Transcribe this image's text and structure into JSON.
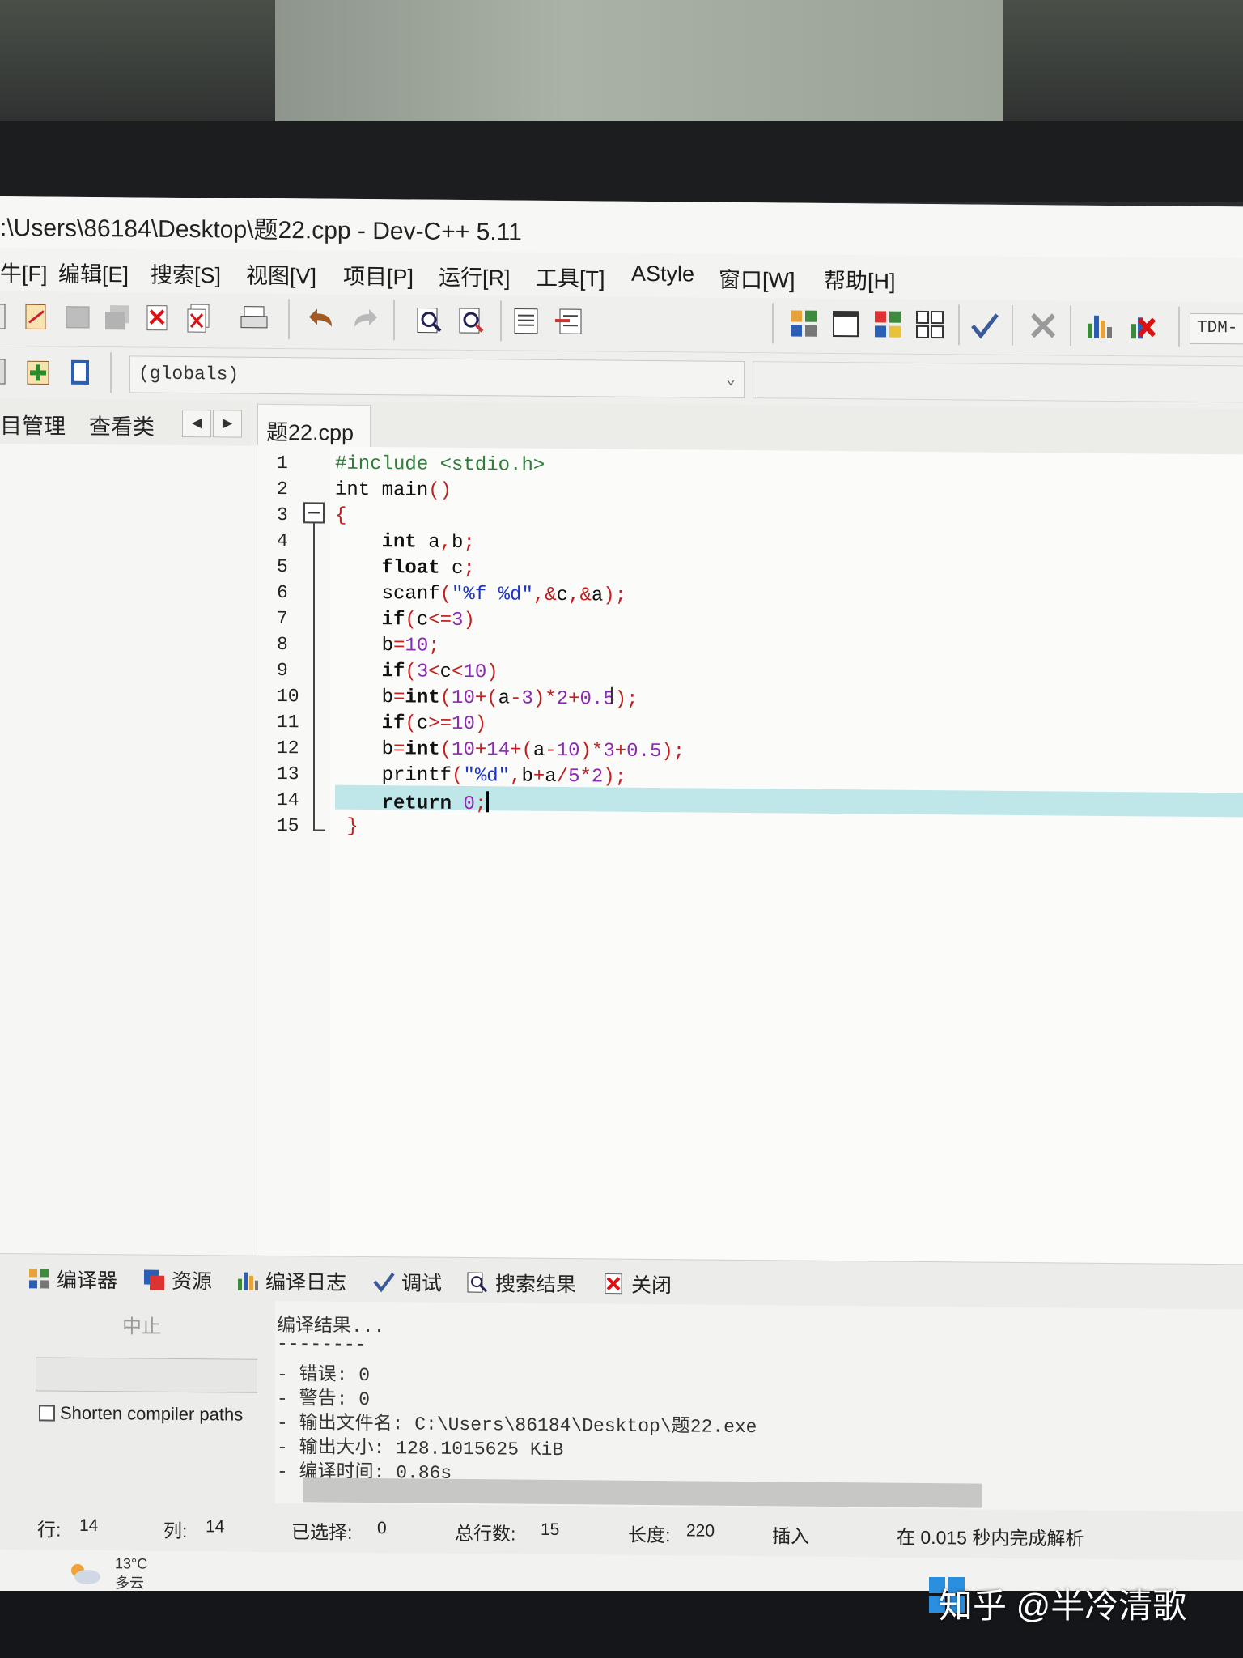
{
  "window": {
    "title": ":\\Users\\86184\\Desktop\\题22.cpp - Dev-C++ 5.11"
  },
  "menu": [
    "牛[F]",
    "编辑[E]",
    "搜索[S]",
    "视图[V]",
    "项目[P]",
    "运行[R]",
    "工具[T]",
    "AStyle",
    "窗口[W]",
    "帮助[H]"
  ],
  "toolbar": {
    "compiler_set": "TDM-"
  },
  "globals_combo": "(globals)",
  "left_tabs": [
    "目管理",
    "查看类"
  ],
  "file_tab": "题22.cpp",
  "editor": {
    "line_numbers": [
      "1",
      "2",
      "3",
      "4",
      "5",
      "6",
      "7",
      "8",
      "9",
      "10",
      "11",
      "12",
      "13",
      "14",
      "15"
    ],
    "current_line": 14
  },
  "bottom_tabs": [
    "编译器",
    "资源",
    "编译日志",
    "调试",
    "搜索结果",
    "关闭"
  ],
  "compiler_panel": {
    "abort_label": "中止",
    "shorten_label": "Shorten compiler paths"
  },
  "compile_log": [
    "编译结果...",
    "--------",
    "- 错误: 0",
    "- 警告: 0",
    "- 输出文件名: C:\\Users\\86184\\Desktop\\题22.exe",
    "- 输出大小: 128.1015625 KiB",
    "- 编译时间: 0.86s"
  ],
  "status": {
    "row_label": "行:",
    "row_value": "14",
    "col_label": "列:",
    "col_value": "14",
    "selected_label": "已选择:",
    "selected_value": "0",
    "total_label": "总行数:",
    "total_value": "15",
    "length_label": "长度:",
    "length_value": "220",
    "mode": "插入",
    "parse_msg": "在 0.015 秒内完成解析"
  },
  "taskbar": {
    "temperature": "13°C",
    "condition": "多云"
  },
  "watermark": "知乎 @半冷清歌",
  "colors": {
    "current_line_highlight": "#bfe7ea",
    "preprocessor": "#2f7d3a",
    "string": "#1a35c8",
    "number": "#8a2bb0",
    "symbol": "#c21f1f"
  }
}
